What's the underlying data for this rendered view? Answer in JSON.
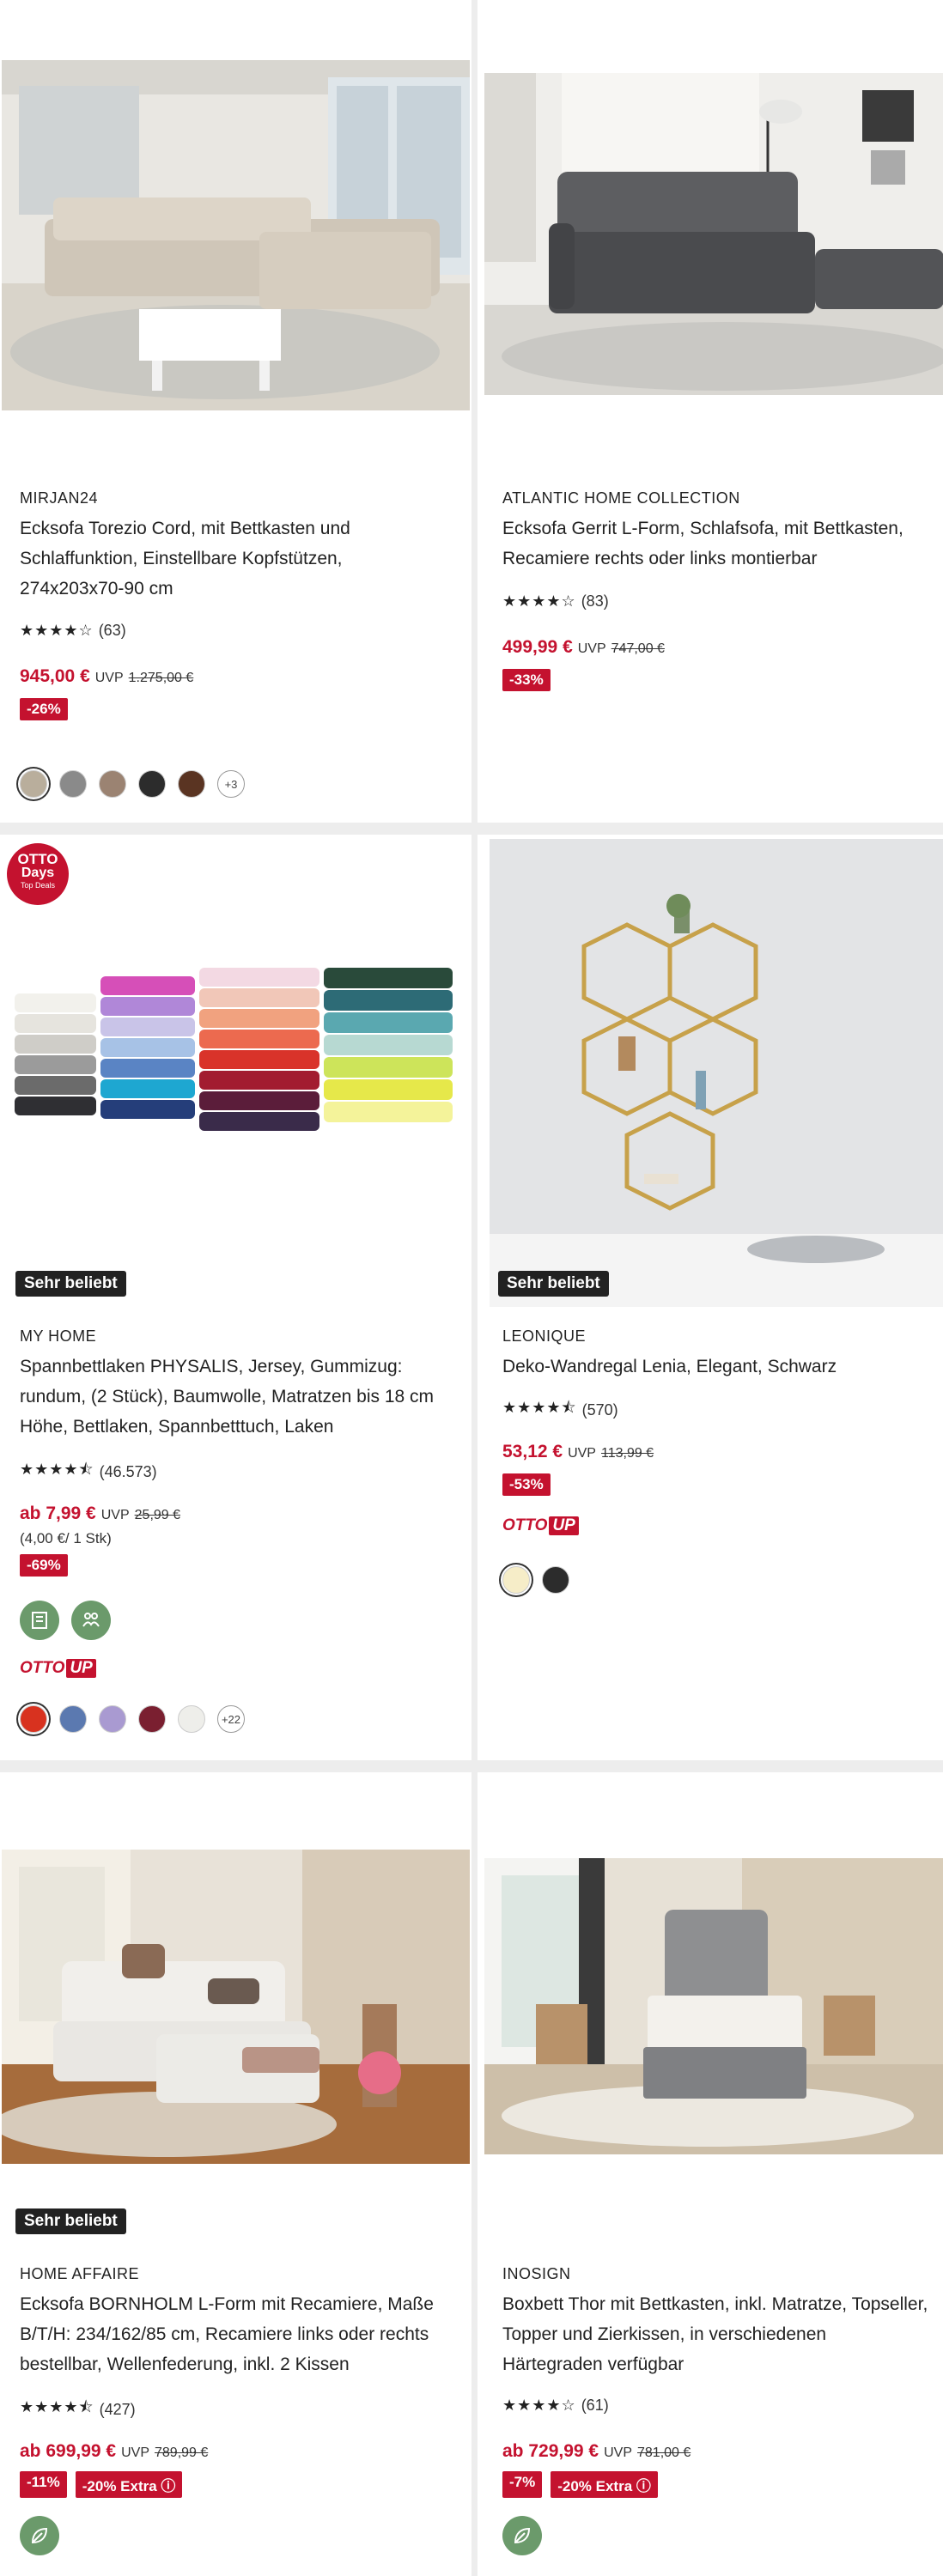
{
  "products": [
    {
      "brand": "MIRJAN24",
      "title_lines": [
        "Ecksofa Torezio Cord, mit Bettkasten und",
        "Schlaffunktion, Einstellbare Kopfstützen,",
        "274x203x70-90 cm"
      ],
      "stars": "★★★★☆",
      "rating_count": "(63)",
      "price": "945,00 €",
      "uvp_label": "UVP",
      "old_price": "1.275,00 €",
      "tags": [
        "-26%"
      ],
      "swatch_colors": [
        "#b9ae9c",
        "#8a8a8a",
        "#9b8372",
        "#2c2c2c",
        "#5a3422"
      ],
      "more_colors": "+3"
    },
    {
      "brand": "ATLANTIC HOME COLLECTION",
      "title_lines": [
        "Ecksofa Gerrit L-Form, Schlafsofa, mit Bettkasten,",
        "Recamiere rechts oder links montierbar"
      ],
      "stars": "★★★★☆",
      "rating_count": "(83)",
      "price": "499,99 €",
      "uvp_label": "UVP",
      "old_price": "747,00 €",
      "tags": [
        "-33%"
      ]
    },
    {
      "popular": "Sehr beliebt",
      "otto_days": [
        "OTTO",
        "Days",
        "Top Deals"
      ],
      "brand": "MY HOME",
      "title_lines": [
        "Spannbettlaken PHYSALIS, Jersey, Gummizug:",
        "rundum, (2 Stück), Baumwolle, Matratzen bis 18 cm",
        "Höhe, Bettlaken, Spannbetttuch, Laken"
      ],
      "stars": "★★★★⯪",
      "rating_count": "(46.573)",
      "price": "ab 7,99 €",
      "uvp_label": "UVP",
      "old_price": "25,99 €",
      "unit_price": "(4,00 €/ 1 Stk)",
      "tags": [
        "-69%"
      ],
      "ottoup": [
        "OTTO",
        "UP"
      ],
      "swatch_colors": [
        "#d8321f",
        "#5b79b0",
        "#a99ad1",
        "#7a1f30",
        "#eeeeea"
      ],
      "more_colors": "+22"
    },
    {
      "popular": "Sehr beliebt",
      "brand": "LEONIQUE",
      "title_lines": [
        "Deko-Wandregal Lenia, Elegant, Schwarz"
      ],
      "stars": "★★★★⯪",
      "rating_count": "(570)",
      "price": "53,12 €",
      "uvp_label": "UVP",
      "old_price": "113,99 €",
      "tags": [
        "-53%"
      ],
      "ottoup": [
        "OTTO",
        "UP"
      ],
      "swatch_colors": [
        "#f6edc8",
        "#2c2c2c"
      ]
    },
    {
      "popular": "Sehr beliebt",
      "brand": "HOME AFFAIRE",
      "title_lines": [
        "Ecksofa BORNHOLM L-Form mit Recamiere, Maße",
        "B/T/H: 234/162/85 cm, Recamiere links oder rechts",
        "bestellbar, Wellenfederung, inkl. 2 Kissen"
      ],
      "stars": "★★★★⯪",
      "rating_count": "(427)",
      "price": "ab 699,99 €",
      "uvp_label": "UVP",
      "old_price": "789,99 €",
      "tags": [
        "-11%",
        "-20% Extra ⓘ"
      ]
    },
    {
      "brand": "INOSIGN",
      "title_lines": [
        "Boxbett Thor mit Bettkasten, inkl. Matratze, Topseller,",
        "Topper und Zierkissen, in verschiedenen",
        "Härtegraden verfügbar"
      ],
      "stars": "★★★★☆",
      "rating_count": "(61)",
      "price": "ab 729,99 €",
      "uvp_label": "UVP",
      "old_price": "781,00 €",
      "tags": [
        "-7%",
        "-20% Extra ⓘ"
      ]
    }
  ]
}
